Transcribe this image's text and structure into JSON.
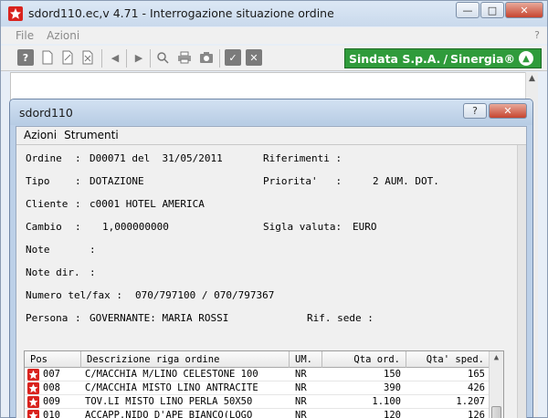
{
  "window": {
    "title": "sdord110.ec,v 4.71 - Interrogazione situazione ordine",
    "controls": [
      "minimize",
      "maximize",
      "close"
    ]
  },
  "main_menu": [
    {
      "label": "File"
    },
    {
      "label": "Azioni"
    }
  ],
  "help_mark": "?",
  "toolbar": {
    "icons": [
      "help-icon",
      "new-document-icon",
      "edit-document-icon",
      "delete-document-icon",
      "previous-icon",
      "next-icon",
      "search-icon",
      "print-icon",
      "camera-icon",
      "confirm-check-icon",
      "cancel-x-icon"
    ]
  },
  "brand": {
    "company": "Sindata S.p.A.",
    "product": "Sinergia®"
  },
  "dialog": {
    "title": "sdord110",
    "menu": [
      {
        "label": "Azioni"
      },
      {
        "label": "Strumenti"
      }
    ]
  },
  "form": {
    "ordine_label": "Ordine",
    "ordine_value": "D00071 del  31/05/2011",
    "riferimenti_label": "Riferimenti :",
    "tipo_label": "Tipo",
    "tipo_value": "DOTAZIONE",
    "priorita_label": "Priorita'   :",
    "priorita_value": "2 AUM. DOT.",
    "cliente_label": "Cliente",
    "cliente_value": "c0001 HOTEL AMERICA",
    "cambio_label": "Cambio",
    "cambio_value": "1,000000000",
    "sigla_label": "Sigla valuta:",
    "sigla_value": "EURO",
    "note_label": "Note",
    "note_dir_label": "Note dir.",
    "tel_label": "Numero tel/fax :",
    "tel_value": "070/797100 / 070/797367",
    "persona_label": "Persona",
    "persona_value": "GOVERNANTE: MARIA ROSSI",
    "rif_sede_label": "Rif. sede :"
  },
  "grid": {
    "headers": {
      "pos": "Pos",
      "desc": "Descrizione riga ordine",
      "um": "UM.",
      "qta_ord": "Qta ord.",
      "qta_sped": "Qta' sped."
    },
    "rows": [
      {
        "pos": "007",
        "desc": "C/MACCHIA M/LINO CELESTONE 100",
        "um": "NR",
        "qta_ord": "150",
        "qta_sped": "165"
      },
      {
        "pos": "008",
        "desc": "C/MACCHIA MISTO LINO ANTRACITE",
        "um": "NR",
        "qta_ord": "390",
        "qta_sped": "426"
      },
      {
        "pos": "009",
        "desc": "TOV.LI MISTO LINO PERLA 50X50",
        "um": "NR",
        "qta_ord": "1.100",
        "qta_sped": "1.207"
      },
      {
        "pos": "010",
        "desc": "ACCAPP.NIDO D'APE BIANCO(LOGO",
        "um": "NR",
        "qta_ord": "120",
        "qta_sped": "126"
      }
    ]
  },
  "colors": {
    "brand_green": "#2f9b3b",
    "row_icon_red": "#d9231e"
  }
}
